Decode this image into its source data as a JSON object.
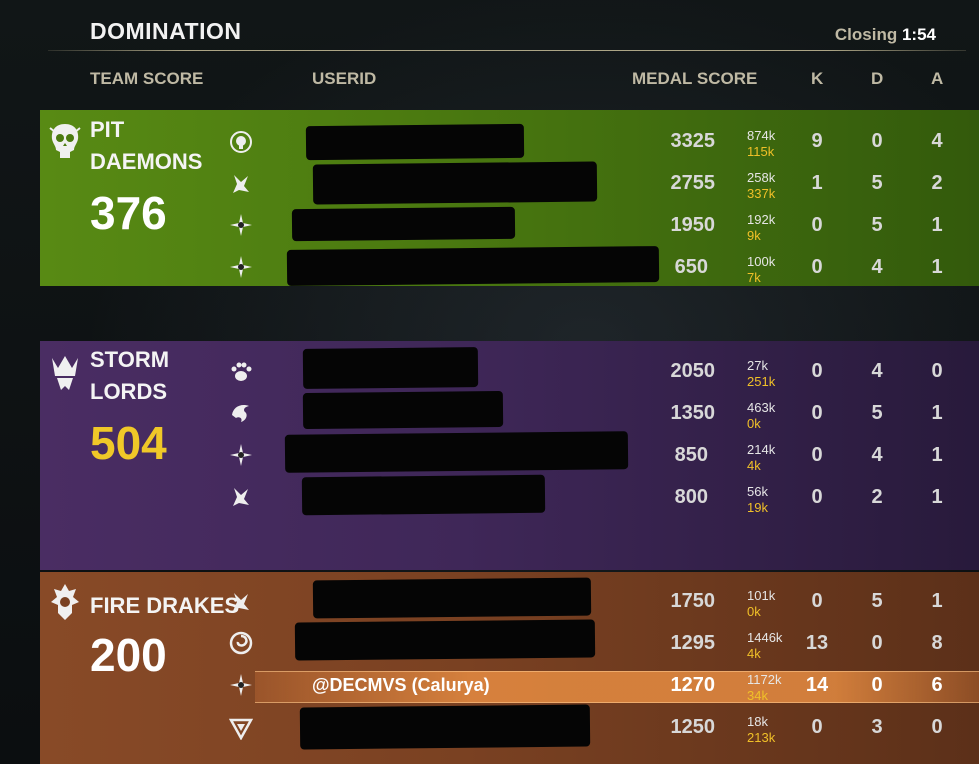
{
  "header": {
    "title": "DOMINATION",
    "closing_label": "Closing",
    "closing_time": "1:54"
  },
  "columns": {
    "team_score": "TEAM SCORE",
    "userid": "USERID",
    "medal_score": "MEDAL SCORE",
    "k": "K",
    "d": "D",
    "a": "A"
  },
  "colors": {
    "green_team": "#588a14",
    "purple_team": "#4a2d63",
    "orange_team": "#884a27",
    "gold": "#f0c828"
  },
  "teams": [
    {
      "name_line1": "PIT",
      "name_line2": "DAEMONS",
      "score": "376",
      "emblem_icon": "skull-emblem-icon",
      "players": [
        {
          "class_icon": "skull-class-icon",
          "medal": "3325",
          "dmg": "874k",
          "heal": "115k",
          "k": "9",
          "d": "0",
          "a": "4"
        },
        {
          "class_icon": "dragonknight-class-icon",
          "medal": "2755",
          "dmg": "258k",
          "heal": "337k",
          "k": "1",
          "d": "5",
          "a": "2"
        },
        {
          "class_icon": "star-class-icon",
          "medal": "1950",
          "dmg": "192k",
          "heal": "9k",
          "k": "0",
          "d": "5",
          "a": "1"
        },
        {
          "class_icon": "star-class-icon",
          "medal": "650",
          "dmg": "100k",
          "heal": "7k",
          "k": "0",
          "d": "4",
          "a": "1"
        }
      ]
    },
    {
      "name_line1": "STORM",
      "name_line2": "LORDS",
      "score": "504",
      "emblem_icon": "crown-emblem-icon",
      "players": [
        {
          "class_icon": "bear-paw-class-icon",
          "medal": "2050",
          "dmg": "27k",
          "heal": "251k",
          "k": "0",
          "d": "4",
          "a": "0"
        },
        {
          "class_icon": "dragon-class-icon",
          "medal": "1350",
          "dmg": "463k",
          "heal": "0k",
          "k": "0",
          "d": "5",
          "a": "1"
        },
        {
          "class_icon": "star-class-icon",
          "medal": "850",
          "dmg": "214k",
          "heal": "4k",
          "k": "0",
          "d": "4",
          "a": "1"
        },
        {
          "class_icon": "dragonknight-class-icon",
          "medal": "800",
          "dmg": "56k",
          "heal": "19k",
          "k": "0",
          "d": "2",
          "a": "1"
        }
      ]
    },
    {
      "name_line1": "FIRE DRAKES",
      "name_line2": "",
      "score": "200",
      "emblem_icon": "drake-emblem-icon",
      "players": [
        {
          "class_icon": "dragonknight-class-icon",
          "medal": "1750",
          "dmg": "101k",
          "heal": "0k",
          "k": "0",
          "d": "5",
          "a": "1"
        },
        {
          "class_icon": "swirl-class-icon",
          "medal": "1295",
          "dmg": "1446k",
          "heal": "4k",
          "k": "13",
          "d": "0",
          "a": "8"
        },
        {
          "class_icon": "star-class-icon",
          "userid": "@DECMVS (Calurya)",
          "medal": "1270",
          "dmg": "1172k",
          "heal": "34k",
          "k": "14",
          "d": "0",
          "a": "6"
        },
        {
          "class_icon": "triangle-class-icon",
          "medal": "1250",
          "dmg": "18k",
          "heal": "213k",
          "k": "0",
          "d": "3",
          "a": "0"
        }
      ]
    }
  ]
}
